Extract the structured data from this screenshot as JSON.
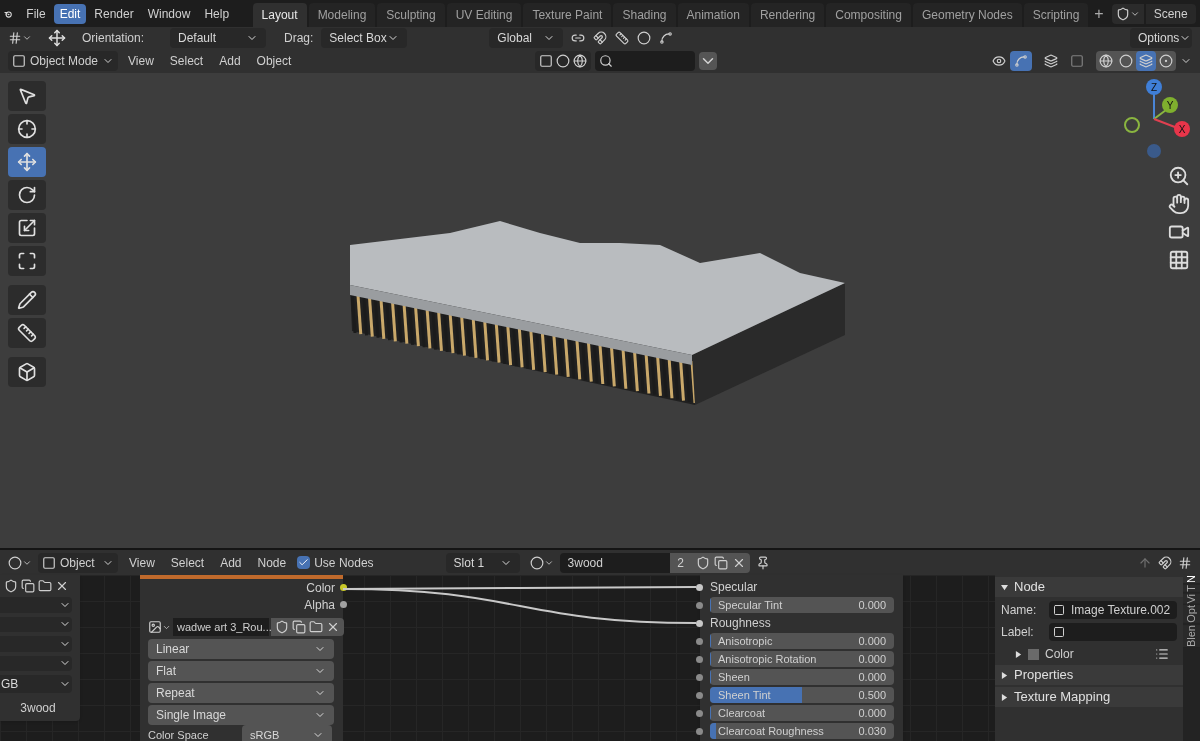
{
  "menu_bar": {
    "menus": [
      {
        "label": "File",
        "selected": false
      },
      {
        "label": "Edit",
        "selected": true
      },
      {
        "label": "Render",
        "selected": false
      },
      {
        "label": "Window",
        "selected": false
      },
      {
        "label": "Help",
        "selected": false
      }
    ],
    "workspaces": [
      {
        "label": "Layout",
        "selected": true
      },
      {
        "label": "Modeling",
        "selected": false
      },
      {
        "label": "Sculpting",
        "selected": false
      },
      {
        "label": "UV Editing",
        "selected": false
      },
      {
        "label": "Texture Paint",
        "selected": false
      },
      {
        "label": "Shading",
        "selected": false
      },
      {
        "label": "Animation",
        "selected": false
      },
      {
        "label": "Rendering",
        "selected": false
      },
      {
        "label": "Compositing",
        "selected": false
      },
      {
        "label": "Geometry Nodes",
        "selected": false
      },
      {
        "label": "Scripting",
        "selected": false
      }
    ],
    "add_workspace": "+",
    "scene": "Scene"
  },
  "tool_header": {
    "orientation_label": "Orientation:",
    "orientation": "Default",
    "drag_label": "Drag:",
    "drag": "Select Box",
    "transform_orientation": "Global",
    "options": "Options"
  },
  "viewport_header": {
    "mode": "Object Mode",
    "menus": [
      "View",
      "Select",
      "Add",
      "Object"
    ],
    "gizmo_on": true,
    "shading": [
      {
        "kind": "wireframe",
        "selected": false
      },
      {
        "kind": "solid",
        "selected": false
      },
      {
        "kind": "material",
        "selected": true
      },
      {
        "kind": "rendered",
        "selected": false
      }
    ]
  },
  "toolbar": [
    {
      "kind": "select_box",
      "selected": false
    },
    {
      "kind": "cursor",
      "selected": false
    },
    {
      "kind": "move",
      "selected": true
    },
    {
      "kind": "rotate",
      "selected": false
    },
    {
      "kind": "scale",
      "selected": false
    },
    {
      "kind": "transform",
      "selected": false
    },
    {
      "kind": "annotate",
      "selected": false
    },
    {
      "kind": "measure",
      "selected": false
    },
    {
      "kind": "add_cube",
      "selected": false
    }
  ],
  "gizmo": {
    "z": "Z",
    "y": "Y",
    "x": "X"
  },
  "node_editor": {
    "header": {
      "type": "Object",
      "menus": [
        "View",
        "Select",
        "Add",
        "Node"
      ],
      "use_nodes": {
        "label": "Use Nodes",
        "checked": true
      },
      "slot": "Slot 1",
      "material": "3wood",
      "users": "2"
    },
    "left_node": {
      "dropdowns": [
        {
          "kind": "blank"
        },
        {
          "kind": "blank"
        },
        {
          "kind": "blank"
        },
        {
          "kind": "blank"
        },
        {
          "kind": "value",
          "value": "GB"
        }
      ],
      "name": "3wood"
    },
    "image_node": {
      "outputs": [
        "Color",
        "Alpha"
      ],
      "image": "wadwe art 3_Rou...",
      "settings": [
        "Linear",
        "Flat",
        "Repeat",
        "Single Image"
      ],
      "color_space": {
        "label": "Color Space",
        "value": "sRGB"
      }
    },
    "principled_node": {
      "rows": [
        {
          "kind": "socket",
          "label": "Specular",
          "linked": true
        },
        {
          "kind": "slider",
          "label": "Specular Tint",
          "value": "0.000",
          "level": 0
        },
        {
          "kind": "socket",
          "label": "Roughness",
          "linked": true
        },
        {
          "kind": "slider",
          "label": "Anisotropic",
          "value": "0.000",
          "level": 0
        },
        {
          "kind": "slider",
          "label": "Anisotropic Rotation",
          "value": "0.000",
          "level": 0
        },
        {
          "kind": "slider",
          "label": "Sheen",
          "value": "0.000",
          "level": 0
        },
        {
          "kind": "slider",
          "label": "Sheen Tint",
          "value": "0.500",
          "level": 0.5
        },
        {
          "kind": "slider",
          "label": "Clearcoat",
          "value": "0.000",
          "level": 0
        },
        {
          "kind": "slider",
          "label": "Clearcoat Roughness",
          "value": "0.030",
          "level": 0.03
        }
      ]
    },
    "sidebar": {
      "panels": [
        {
          "title": "Node",
          "expanded": true,
          "fields": [
            {
              "label": "Name:",
              "value": "Image Texture.002"
            },
            {
              "label": "Label:"
            }
          ],
          "subpanel": {
            "title": "Color",
            "expanded": false
          }
        },
        {
          "title": "Properties",
          "expanded": false
        },
        {
          "title": "Texture Mapping",
          "expanded": false
        }
      ],
      "tabs": [
        {
          "label": "N",
          "selected": true
        },
        {
          "label": "T",
          "selected": false
        },
        {
          "label": "Vi",
          "selected": false
        },
        {
          "label": "Opt",
          "selected": false
        },
        {
          "label": "Blen",
          "selected": false
        }
      ]
    }
  }
}
